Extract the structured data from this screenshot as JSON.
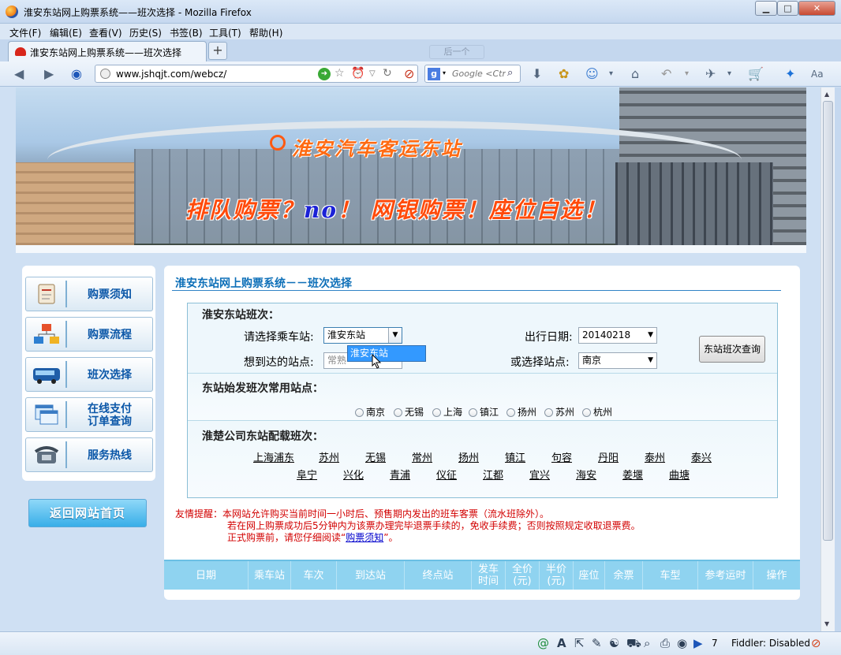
{
  "window": {
    "title": "淮安东站网上购票系统——班次选择 - Mozilla Firefox",
    "min": "▁",
    "max": "□",
    "close": "✕"
  },
  "menu": [
    "文件(F)",
    "编辑(E)",
    "查看(V)",
    "历史(S)",
    "书签(B)",
    "工具(T)",
    "帮助(H)"
  ],
  "tab": {
    "label": "淮安东站网上购票系统——班次选择",
    "new_tab": "+",
    "ghost": "后一个"
  },
  "nav": {
    "url": "www.jshqjt.com/webcz/",
    "search_placeholder": "Google <Ctr",
    "search_engine": "g"
  },
  "banner": {
    "site_name": "淮安汽车客运东站",
    "slogan_1": "排队购票？",
    "slogan_no": "no",
    "slogan_2": "！ 网银购票！座位自选！"
  },
  "sidebar": {
    "items": [
      {
        "label": "购票须知",
        "icon": "notice-icon"
      },
      {
        "label": "购票流程",
        "icon": "flowchart-icon"
      },
      {
        "label": "班次选择",
        "icon": "bus-icon"
      },
      {
        "label": "在线支付\n订单查询",
        "l1": "在线支付",
        "l2": "订单查询",
        "icon": "window-icon"
      },
      {
        "label": "服务热线",
        "icon": "telephone-icon"
      }
    ],
    "back_home": "返回网站首页"
  },
  "main": {
    "heading": "淮安东站网上购票系统－－班次选择",
    "section1_title": "淮安东站班次：",
    "label_station": "请选择乘车站:",
    "station_value": "淮安东站",
    "station_dropdown_option": "淮安东站",
    "label_date": "出行日期:",
    "date_value": "20140218",
    "label_dest": "想到达的站点:",
    "dest_value": "常熟",
    "label_or": "或选择站点:",
    "or_value": "南京",
    "query_button": "东站班次查询",
    "section2_title": "东站始发班次常用站点：",
    "radios": [
      "南京",
      "无锡",
      "上海",
      "镇江",
      "扬州",
      "苏州",
      "杭州"
    ],
    "section3_title": "淮楚公司东站配载班次：",
    "links_row1": [
      "上海浦东",
      "苏州",
      "无锡",
      "常州",
      "扬州",
      "镇江",
      "句容",
      "丹阳",
      "泰州",
      "泰兴"
    ],
    "links_row2": [
      "阜宁",
      "兴化",
      "青浦",
      "仪征",
      "江都",
      "宜兴",
      "海安",
      "姜堰",
      "曲塘"
    ],
    "notice_1": "友情提醒：本网站允许购买当前时间一小时后、预售期内发出的班车客票（流水班除外）。",
    "notice_2": "若在网上购票成功后5分钟内为该票办理完毕退票手续的，免收手续费；否则按照规定收取退票费。",
    "notice_3_pre": "正式购票前，请您仔细阅读“",
    "notice_3_link": "购票须知",
    "notice_3_post": "”。",
    "table_headers": [
      {
        "l1": "日期"
      },
      {
        "l1": "乘车站"
      },
      {
        "l1": "车次"
      },
      {
        "l1": "到达站"
      },
      {
        "l1": "终点站"
      },
      {
        "l1": "发车",
        "l2": "时间"
      },
      {
        "l1": "全价",
        "l2": "(元)"
      },
      {
        "l1": "半价",
        "l2": "(元)"
      },
      {
        "l1": "座位"
      },
      {
        "l1": "余票"
      },
      {
        "l1": "车型"
      },
      {
        "l1": "参考运时"
      },
      {
        "l1": "操作"
      }
    ]
  },
  "status": {
    "count": "7",
    "fiddler": "Fiddler: Disabled"
  },
  "colors": {
    "accent": "#0d6fb8",
    "header_bg": "#8fd3f0",
    "notice_red": "#d20000",
    "dropdown_blue": "#3399ff"
  }
}
